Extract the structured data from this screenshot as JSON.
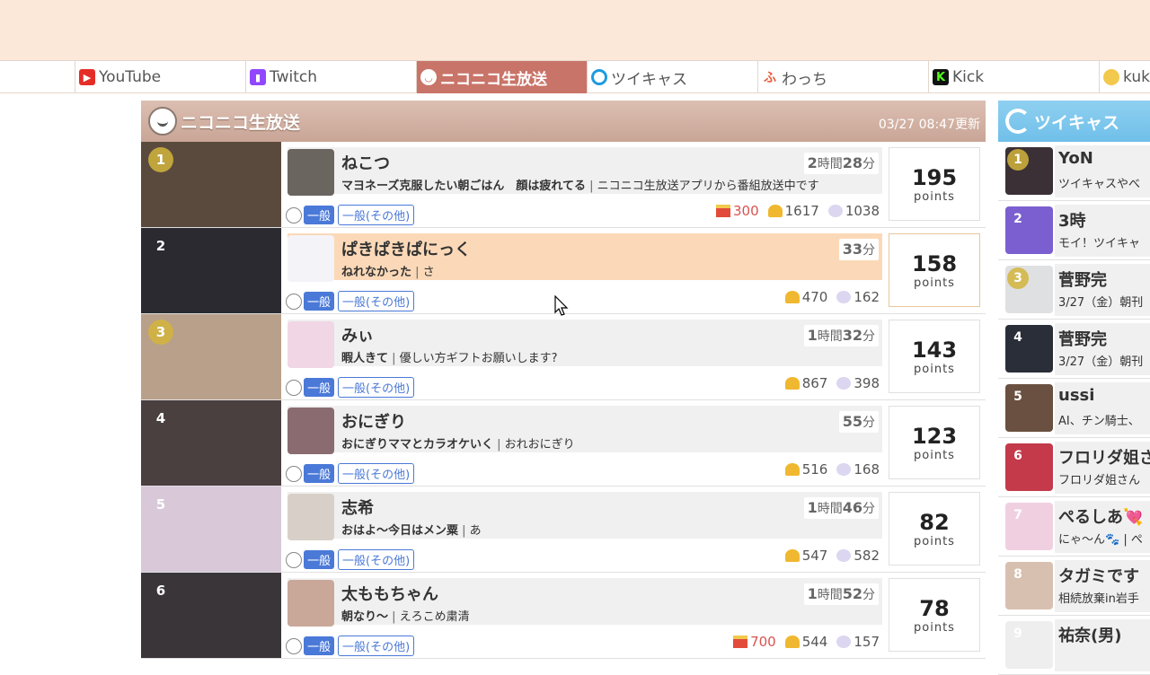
{
  "tabs": [
    {
      "label": "YouTube",
      "icon": "youtube-icon",
      "color": "#e52d27",
      "active": false
    },
    {
      "label": "Twitch",
      "icon": "twitch-icon",
      "color": "#9146ff",
      "active": false
    },
    {
      "label": "ニコニコ生放送",
      "icon": "niconico-icon",
      "color": "#c97468",
      "active": true
    },
    {
      "label": "ツイキャス",
      "icon": "twitcasting-icon",
      "color": "#1e9bdf",
      "active": false
    },
    {
      "label": "わっち",
      "icon": "whowatch-icon",
      "color": "#e85a3a",
      "active": false
    },
    {
      "label": "Kick",
      "icon": "kick-icon",
      "color": "#53fc18",
      "active": false
    },
    {
      "label": "kuk",
      "icon": "kuku-icon",
      "color": "#f2c94c",
      "active": false
    }
  ],
  "main": {
    "title": "ニコニコ生放送",
    "updated": "03/27 08:47更新",
    "points_label": "points",
    "rows": [
      {
        "rank": "1",
        "name": "ねこつ",
        "title": "マヨネーズ克服したい朝ごはん　顔は疲れてる",
        "sub": "ニコニコ生放送アプリから番組放送中です",
        "dur_big1": "2",
        "dur_s1": "時間",
        "dur_big2": "28",
        "dur_s2": "分",
        "cat": "一般",
        "subcat": "一般(その他)",
        "gift": "300",
        "viewers": "1617",
        "comments": "1038",
        "points": "195"
      },
      {
        "rank": "2",
        "name": "ぱきぱきぱにっく",
        "title": "ねれなかった",
        "sub": "さ",
        "dur_big1": "",
        "dur_s1": "",
        "dur_big2": "33",
        "dur_s2": "分",
        "cat": "一般",
        "subcat": "一般(その他)",
        "gift": "",
        "viewers": "470",
        "comments": "162",
        "points": "158"
      },
      {
        "rank": "3",
        "name": "みぃ",
        "title": "暇人きて",
        "sub": "優しい方ギフトお願いします?",
        "dur_big1": "1",
        "dur_s1": "時間",
        "dur_big2": "32",
        "dur_s2": "分",
        "cat": "一般",
        "subcat": "一般(その他)",
        "gift": "",
        "viewers": "867",
        "comments": "398",
        "points": "143"
      },
      {
        "rank": "4",
        "name": "おにぎり",
        "title": "おにぎりママとカラオケいく",
        "sub": "おれおにぎり",
        "dur_big1": "",
        "dur_s1": "",
        "dur_big2": "55",
        "dur_s2": "分",
        "cat": "一般",
        "subcat": "一般(その他)",
        "gift": "",
        "viewers": "516",
        "comments": "168",
        "points": "123"
      },
      {
        "rank": "5",
        "name": "志希",
        "title": "おはよ～今日はメン粟",
        "sub": "あ",
        "dur_big1": "1",
        "dur_s1": "時間",
        "dur_big2": "46",
        "dur_s2": "分",
        "cat": "一般",
        "subcat": "一般(その他)",
        "gift": "",
        "viewers": "547",
        "comments": "582",
        "points": "82"
      },
      {
        "rank": "6",
        "name": "太ももちゃん",
        "title": "朝なり～",
        "sub": "えろこめ粛清",
        "dur_big1": "1",
        "dur_s1": "時間",
        "dur_big2": "52",
        "dur_s2": "分",
        "cat": "一般",
        "subcat": "一般(その他)",
        "gift": "700",
        "viewers": "544",
        "comments": "157",
        "points": "78"
      }
    ]
  },
  "side": {
    "title": "ツイキャス",
    "rows": [
      {
        "rank": "1",
        "name": "YoN",
        "desc": "ツイキャスやべ"
      },
      {
        "rank": "2",
        "name": "3時",
        "desc": "モイ！ツイキャ"
      },
      {
        "rank": "3",
        "name": "菅野完",
        "desc": "3/27（金）朝刊"
      },
      {
        "rank": "4",
        "name": "菅野完",
        "desc": "3/27（金）朝刊"
      },
      {
        "rank": "5",
        "name": "ussi",
        "desc": "AI、チン騎士、"
      },
      {
        "rank": "6",
        "name": "フロリダ姐さ",
        "desc": "フロリダ姐さん"
      },
      {
        "rank": "7",
        "name": "ぺるしあ💘",
        "desc": "にゃ～ん🐾 | ぺ"
      },
      {
        "rank": "8",
        "name": "タガミです",
        "desc": "相続放棄in岩手"
      },
      {
        "rank": "9",
        "name": "祐奈(男)",
        "desc": ""
      }
    ]
  }
}
